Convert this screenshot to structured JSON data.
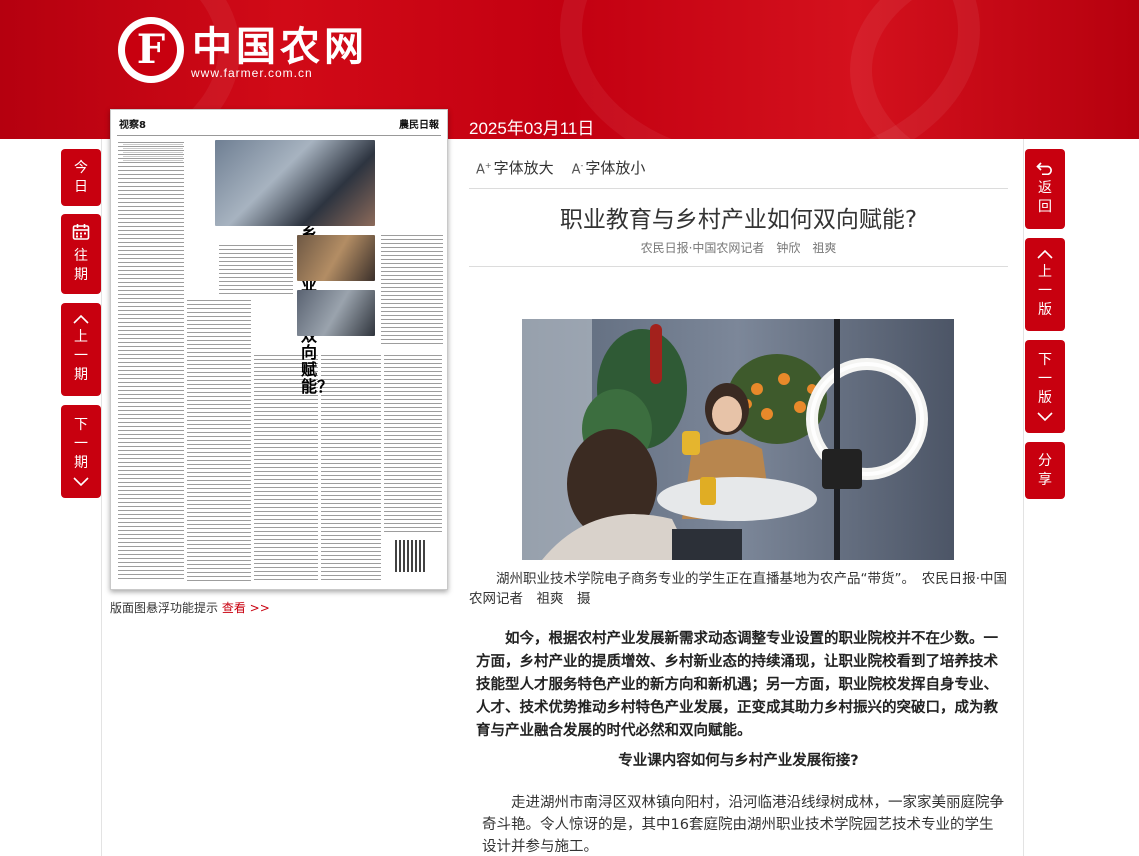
{
  "header": {
    "logo_letter": "F",
    "site_name": "中国农网",
    "site_url": "www.farmer.com.cn",
    "date": "2025年03月11日"
  },
  "left_nav": {
    "today": "今日",
    "archive": "往期",
    "prev_issue": "上一期",
    "next_issue": "下一期"
  },
  "right_nav": {
    "back": "返回",
    "prev_page": "上一版",
    "next_page": "下一版",
    "share": "分享"
  },
  "paper": {
    "page_label": "视察8",
    "paper_name": "農民日報",
    "headline": "职业教育与乡村产业如何双向赋能？"
  },
  "float_tip": {
    "text": "版面图悬浮功能提示",
    "link": "查看 >>"
  },
  "toolbar": {
    "enlarge": "字体放大",
    "shrink": "字体放小"
  },
  "article": {
    "title": "职业教育与乡村产业如何双向赋能?",
    "byline": "农民日报·中国农网记者　钟欣　祖爽",
    "caption": "湖州职业技术学院电子商务专业的学生正在直播基地为农产品“带货”。　农民日报·中国农网记者　祖爽　摄",
    "lead": "如今，根据农村产业发展新需求动态调整专业设置的职业院校并不在少数。一方面，乡村产业的提质增效、乡村新业态的持续涌现，让职业院校看到了培养技术技能型人才服务特色产业的新方向和新机遇；另一方面，职业院校发挥自身专业、人才、技术优势推动乡村特色产业发展，正变成其助力乡村振兴的突破口，成为教育与产业融合发展的时代必然和双向赋能。",
    "subhead": "专业课内容如何与乡村产业发展衔接?",
    "body": "走进湖州市南浔区双林镇向阳村，沿河临港沿线绿树成林，一家家美丽庭院争奇斗艳。令人惊讶的是，其中16套庭院由湖州职业技术学院园艺技术专业的学生设计并参与施工。"
  },
  "colors": {
    "brand_red": "#c8000f"
  }
}
